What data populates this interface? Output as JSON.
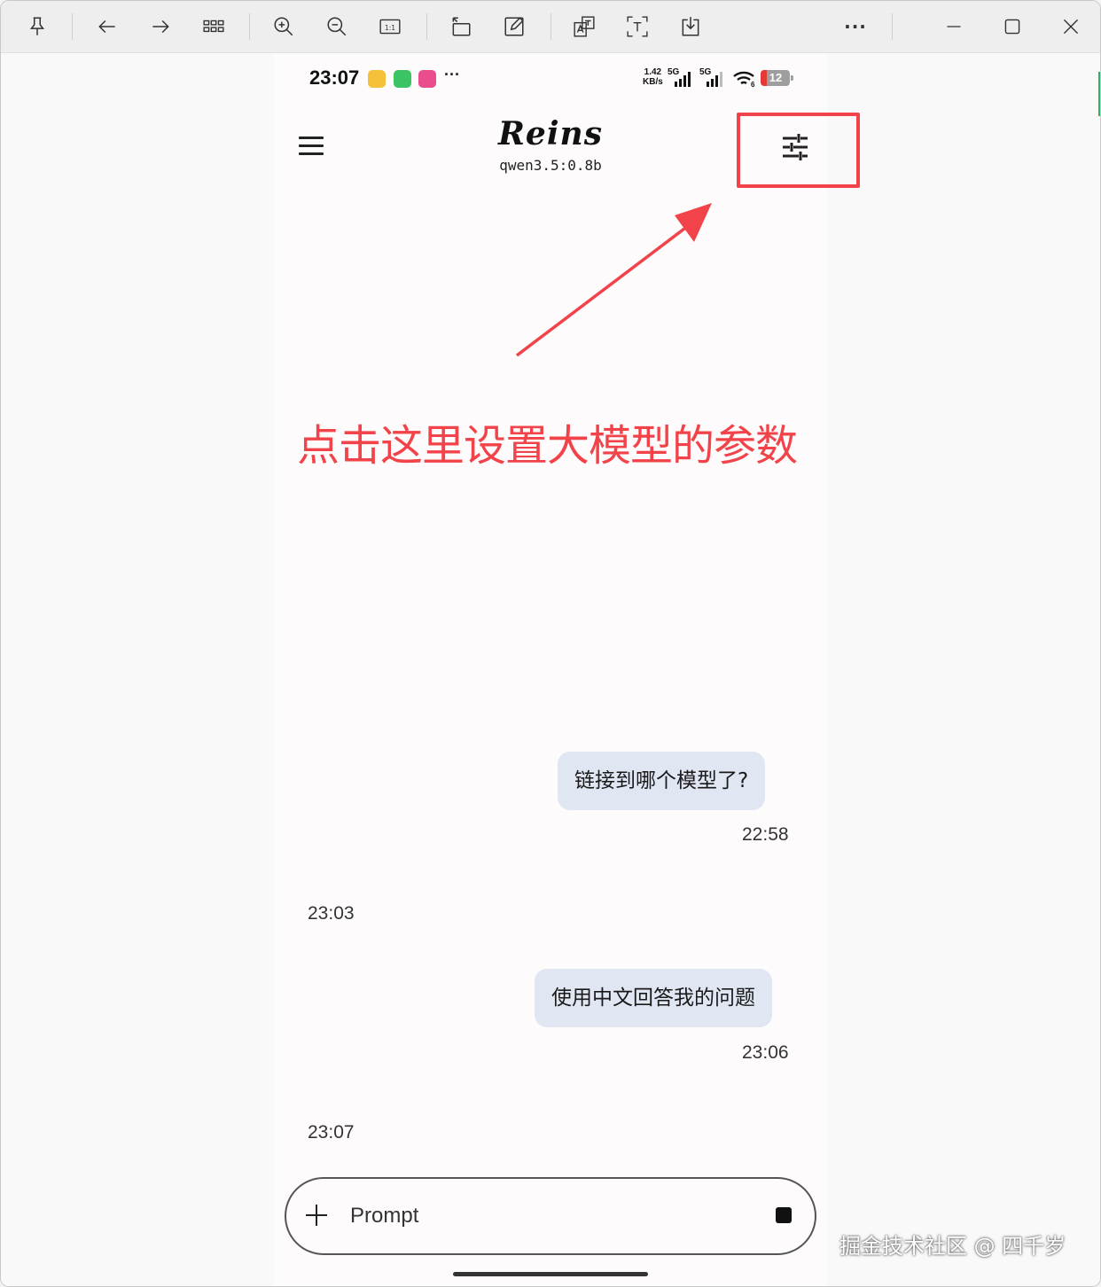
{
  "toolbar": {
    "buttons": [
      {
        "icon": "pin-icon"
      },
      {
        "icon": "arrow-left-icon"
      },
      {
        "icon": "arrow-right-icon"
      },
      {
        "icon": "grid-icon"
      },
      {
        "icon": "zoom-in-icon"
      },
      {
        "icon": "zoom-out-icon"
      },
      {
        "icon": "actual-size-icon"
      },
      {
        "icon": "rotate-icon"
      },
      {
        "icon": "edit-icon"
      },
      {
        "icon": "translate-icon"
      },
      {
        "icon": "text-recognition-icon"
      },
      {
        "icon": "save-icon"
      },
      {
        "icon": "more-icon"
      },
      {
        "icon": "minimize-icon"
      },
      {
        "icon": "maximize-icon"
      },
      {
        "icon": "close-icon"
      }
    ],
    "actual_size_label": "1:1",
    "more_label": "···"
  },
  "status_bar": {
    "time": "23:07",
    "more": "···",
    "speed_value": "1.42",
    "speed_unit": "KB/s",
    "network_1": "5G",
    "network_2": "5G",
    "wifi_sub": "6",
    "battery": "12",
    "app_icon_colors": [
      "#f5c13a",
      "#3bc464",
      "#ea4d8c"
    ]
  },
  "app": {
    "title": "Reins",
    "model": "qwen3.5:0.8b",
    "menu_icon": "hamburger-menu-icon",
    "settings_icon": "tune-sliders-icon"
  },
  "messages": [
    {
      "role": "user",
      "text": "链接到哪个模型了?",
      "time": "22:58"
    },
    {
      "role": "assistant",
      "text": "",
      "time": "23:03"
    },
    {
      "role": "user",
      "text": "使用中文回答我的问题",
      "time": "23:06"
    },
    {
      "role": "assistant",
      "text": "",
      "time": "23:07"
    }
  ],
  "composer": {
    "placeholder": "Prompt",
    "add_icon": "plus-icon",
    "stop_icon": "stop-icon"
  },
  "annotation": {
    "text": "点击这里设置大模型的参数",
    "color": "#f2434a"
  },
  "watermark": "掘金技术社区 @ 四千岁"
}
